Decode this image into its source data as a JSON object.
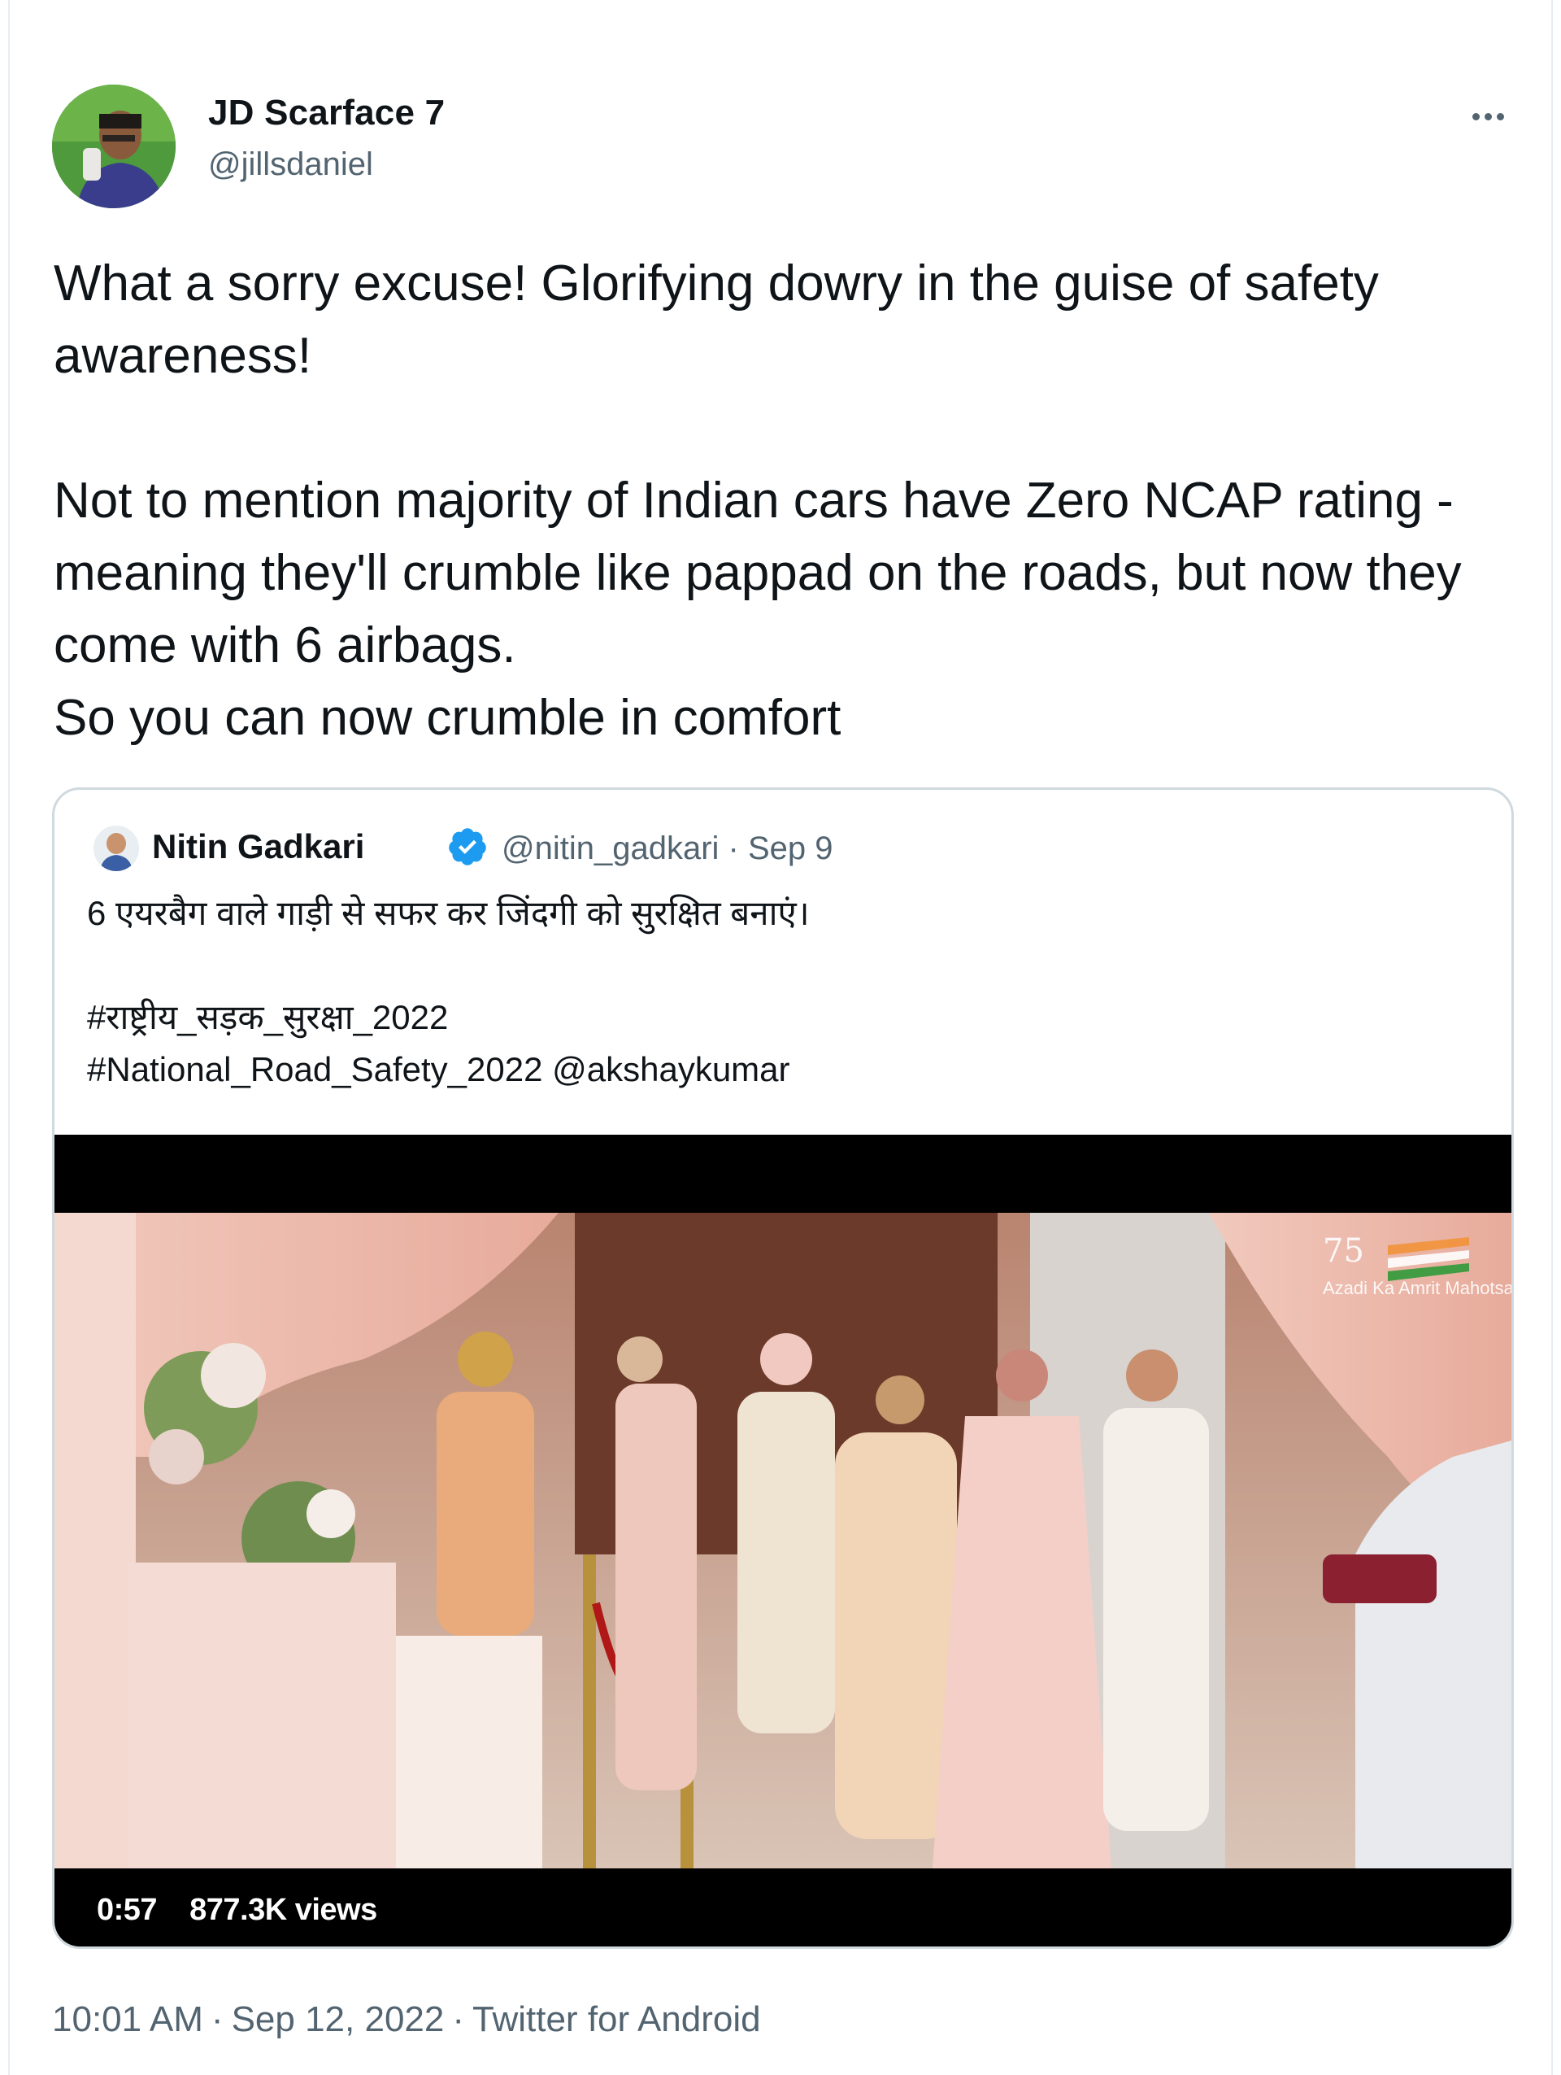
{
  "author": {
    "display_name": "JD Scarface 7",
    "handle": "@jillsdaniel"
  },
  "tweet": {
    "text": "What a sorry excuse! Glorifying dowry in the guise of safety awareness!\n\nNot to mention majority of Indian cars have Zero NCAP rating - meaning they'll crumble like pappad on the roads, but now they come with 6 airbags.\nSo you can now crumble in comfort"
  },
  "quoted_tweet": {
    "display_name": "Nitin Gadkari",
    "handle": "@nitin_gadkari",
    "date": "Sep 9",
    "text": "6 एयरबैग वाले गाड़ी से सफर कर जिंदगी को सुरक्षित बनाएं।\n\n#राष्ट्रीय_सड़क_सुरक्षा_2022\n#National_Road_Safety_2022 @akshaykumar",
    "video": {
      "duration": "0:57",
      "views": "877.3K views",
      "watermark_number": "75",
      "watermark_text": "Azadi Ka Amrit Mahotsav"
    }
  },
  "footer": {
    "time": "10:01 AM",
    "date": "Sep 12, 2022",
    "source": "Twitter for Android"
  },
  "colors": {
    "text": "#0f1419",
    "secondary": "#536471",
    "verified": "#1d9bf0",
    "border": "#cfd9de"
  },
  "icons": {
    "more": "more-horizontal-icon",
    "verified": "verified-badge-icon"
  }
}
